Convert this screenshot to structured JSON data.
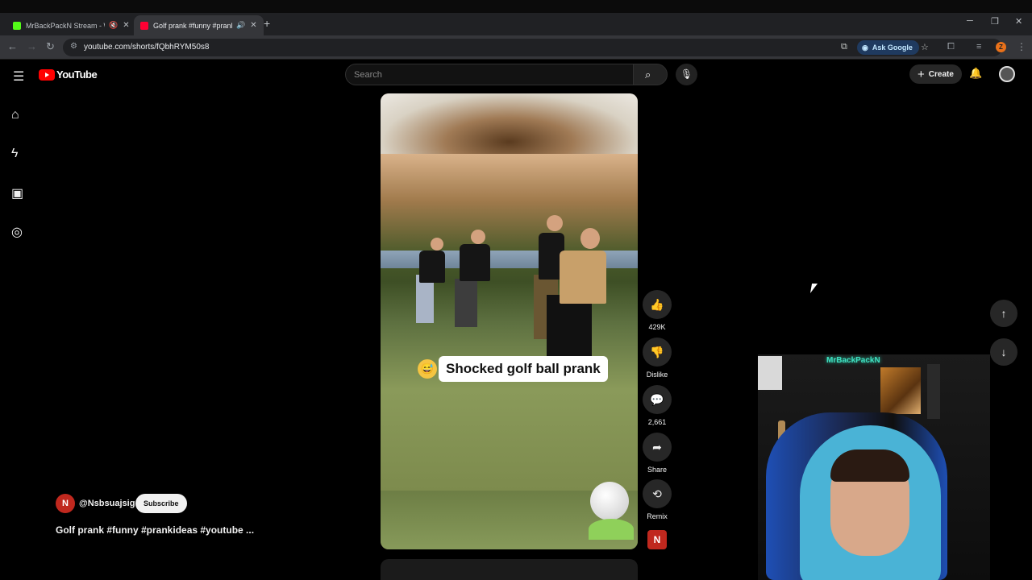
{
  "browser": {
    "tabs": [
      {
        "title": "MrBackPackN Stream - Wa",
        "favicon_color": "#53fc18",
        "active": false,
        "status_icon": "muted-speaker-icon"
      },
      {
        "title": "Golf prank #funny #prankid",
        "favicon_color": "#ff0033",
        "active": true,
        "status_icon": "speaker-icon"
      }
    ],
    "url": "youtube.com/shorts/fQbhRYM50s8",
    "ask_google_label": "Ask Google",
    "profile_letter": "Z"
  },
  "youtube": {
    "logo_text": "YouTube",
    "search_placeholder": "Search",
    "create_label": "Create",
    "rail_icons": [
      "home-icon",
      "shorts-icon",
      "subscriptions-icon",
      "you-icon"
    ]
  },
  "short": {
    "caption": "Shocked golf ball prank",
    "channel_initial": "N",
    "channel_handle": "@Nsbsuajsig",
    "subscribe_label": "Subscribe",
    "title": "Golf prank #funny #prankideas #youtube ...",
    "actions": {
      "like_count": "429K",
      "dislike_label": "Dislike",
      "comment_count": "2,661",
      "share_label": "Share",
      "remix_label": "Remix"
    }
  },
  "webcam": {
    "neon_sign_text": "MrBackPackN"
  }
}
